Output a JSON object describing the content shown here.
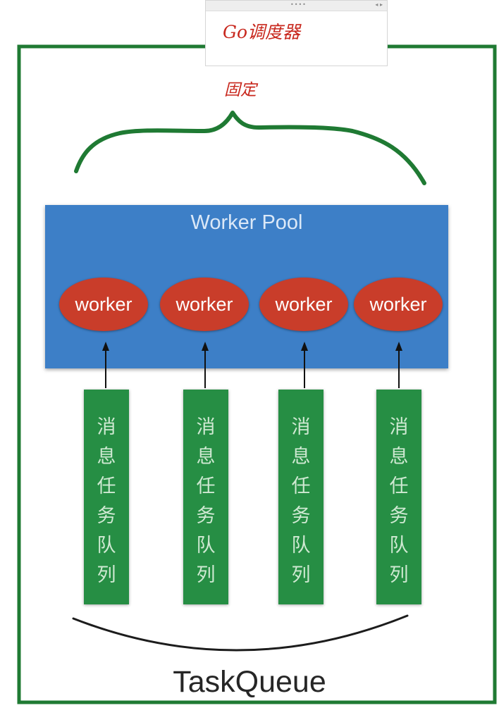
{
  "diagram": {
    "scheduler_title": "Go调度器",
    "fixed_label": "固定",
    "pool_title": "Worker Pool",
    "workers": [
      "worker",
      "worker",
      "worker",
      "worker"
    ],
    "queues": [
      "消息任务队列",
      "消息任务队列",
      "消息任务队列",
      "消息任务队列"
    ],
    "task_queue_label": "TaskQueue"
  },
  "colors": {
    "frame": "#1f7a33",
    "pool": "#3d7fc7",
    "worker": "#c93d2a",
    "queue": "#268e44",
    "annotation": "#c8281e",
    "arrow": "#111111"
  }
}
